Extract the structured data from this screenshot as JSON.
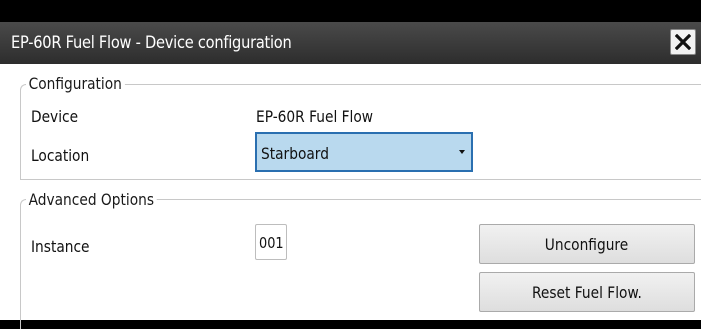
{
  "dialog": {
    "title": "EP-60R Fuel Flow - Device configuration",
    "close_icon": "close-icon"
  },
  "configuration": {
    "legend": "Configuration",
    "device_label": "Device",
    "device_value": "EP-60R Fuel Flow",
    "location_label": "Location",
    "location_value": "Starboard"
  },
  "advanced": {
    "legend": "Advanced Options",
    "instance_label": "Instance",
    "instance_value": "001",
    "unconfigure_label": "Unconfigure",
    "reset_label": "Reset Fuel Flow."
  },
  "colors": {
    "titlebar": "#3a3a3a",
    "select_fill": "#b9d9ee",
    "select_border": "#2a6fb0"
  }
}
